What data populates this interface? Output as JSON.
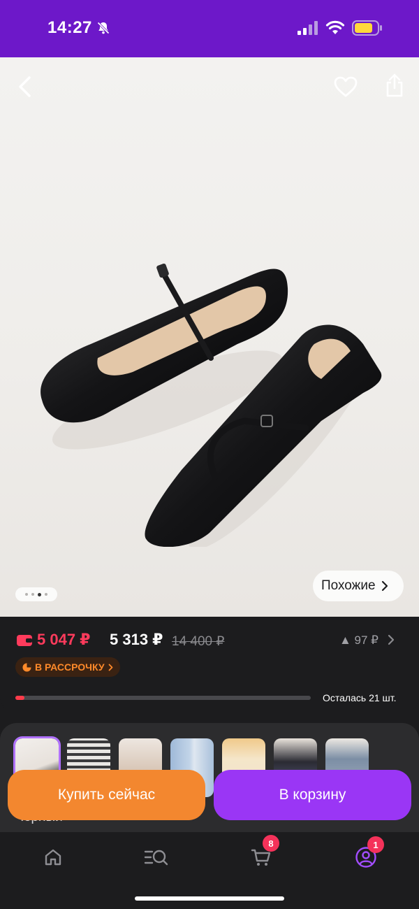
{
  "status_bar": {
    "time": "14:27",
    "background": "#6d18c9",
    "icons": [
      "bell-slash-icon",
      "cellular-signal-icon",
      "wifi-icon",
      "battery-icon"
    ]
  },
  "product": {
    "actions": [
      "back-icon",
      "heart-icon",
      "share-icon"
    ],
    "gallery": {
      "image_count": 4,
      "active_index": 2
    },
    "similar_label": "Похожие"
  },
  "price": {
    "wallet_price": "5 047 ₽",
    "price": "5 313 ₽",
    "old_price": "14 400 ₽",
    "price_change": "▲ 97 ₽",
    "installment_label": "В РАССРОЧКУ",
    "stock_progress": 0.03,
    "stock_text": "Осталась 21 шт.",
    "colors": {
      "wallet": "#ff3b5c",
      "installment": "#ff8a2a"
    }
  },
  "variants": {
    "thumbnails": [
      "black-flats",
      "striped-outfit",
      "black-sandals",
      "jeans",
      "beige-flats",
      "black-dress",
      "blue-dress"
    ],
    "active_index": 0,
    "color_label": "черный"
  },
  "actions": {
    "buy_now": "Купить сейчас",
    "add_to_cart": "В корзину",
    "colors": {
      "buy_now": "#f3872f",
      "add_to_cart": "#9a36f5"
    }
  },
  "tabbar": {
    "items": [
      "home-icon",
      "catalog-search-icon",
      "cart-icon",
      "profile-icon"
    ],
    "cart_badge": "8",
    "profile_badge": "1"
  }
}
